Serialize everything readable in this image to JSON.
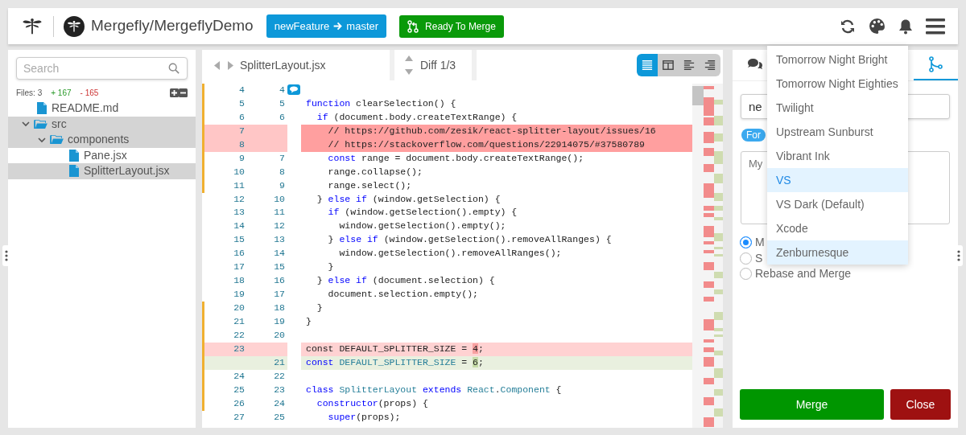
{
  "header": {
    "repo": "Mergefly/MergeflyDemo",
    "branch": {
      "source": "newFeature",
      "target": "master"
    },
    "status_button": "Ready To Merge"
  },
  "sidebar": {
    "search": {
      "placeholder": "Search"
    },
    "files_count": "Files: 3",
    "additions": "+ 167",
    "deletions": "- 165",
    "tree": [
      {
        "kind": "file",
        "name": "README.md",
        "selected": false
      },
      {
        "kind": "folder",
        "name": "src",
        "expanded": true,
        "selected": true,
        "children": [
          {
            "kind": "folder",
            "name": "components",
            "expanded": true,
            "selected": true,
            "children": [
              {
                "kind": "file",
                "name": "Pane.jsx",
                "selected": false
              },
              {
                "kind": "file",
                "name": "SplitterLayout.jsx",
                "selected": true
              }
            ]
          }
        ]
      }
    ]
  },
  "editor": {
    "file": "SplitterLayout.jsx",
    "diff_position": "Diff 1/3",
    "view_modes": [
      {
        "kind": "unified",
        "selected": true
      },
      {
        "kind": "split",
        "selected": false
      },
      {
        "kind": "left",
        "selected": false
      },
      {
        "kind": "right",
        "selected": false
      }
    ],
    "rows": [
      {
        "old": "4",
        "new": "4",
        "kind": "context",
        "hunk": true,
        "comment": true
      },
      {
        "old": "5",
        "new": "5",
        "kind": "context",
        "hunk": true,
        "code": [
          {
            "kind": "keyword",
            "text": "function"
          },
          {
            "kind": "plain",
            "text": " clearSelection() {"
          }
        ]
      },
      {
        "old": "6",
        "new": "6",
        "kind": "context",
        "hunk": true,
        "code": [
          {
            "kind": "keyword",
            "text": "  if"
          },
          {
            "kind": "plain",
            "text": " (document.body.createTextRange) {"
          }
        ]
      },
      {
        "old": "7",
        "kind": "deleted",
        "hunk": true,
        "code": [
          {
            "kind": "plain",
            "text": "    // https://github.com/zesik/react-splitter-layout/issues/16"
          }
        ]
      },
      {
        "old": "8",
        "kind": "deleted",
        "hunk": true,
        "code": [
          {
            "kind": "plain",
            "text": "    // https://stackoverflow.com/questions/22914075/#37580789"
          }
        ]
      },
      {
        "old": "9",
        "new": "7",
        "kind": "context",
        "hunk": true,
        "code": [
          {
            "kind": "keyword",
            "text": "    const"
          },
          {
            "kind": "plain",
            "text": " range = document.body.createTextRange();"
          }
        ]
      },
      {
        "old": "10",
        "new": "8",
        "kind": "context",
        "hunk": true,
        "code": [
          {
            "kind": "plain",
            "text": "    range.collapse();"
          }
        ]
      },
      {
        "old": "11",
        "new": "9",
        "kind": "context",
        "hunk": true,
        "code": [
          {
            "kind": "plain",
            "text": "    range.select();"
          }
        ]
      },
      {
        "old": "12",
        "new": "10",
        "kind": "context",
        "hunk": false,
        "code": [
          {
            "kind": "plain",
            "text": "  } "
          },
          {
            "kind": "keyword",
            "text": "else if"
          },
          {
            "kind": "plain",
            "text": " (window.getSelection) {"
          }
        ]
      },
      {
        "old": "13",
        "new": "11",
        "kind": "context",
        "hunk": false,
        "code": [
          {
            "kind": "keyword",
            "text": "    if"
          },
          {
            "kind": "plain",
            "text": " (window.getSelection().empty) {"
          }
        ]
      },
      {
        "old": "14",
        "new": "12",
        "kind": "context",
        "hunk": false,
        "code": [
          {
            "kind": "plain",
            "text": "      window.getSelection().empty();"
          }
        ]
      },
      {
        "old": "15",
        "new": "13",
        "kind": "context",
        "hunk": false,
        "code": [
          {
            "kind": "plain",
            "text": "    } "
          },
          {
            "kind": "keyword",
            "text": "else if"
          },
          {
            "kind": "plain",
            "text": " (window.getSelection().removeAllRanges) {"
          }
        ]
      },
      {
        "old": "16",
        "new": "14",
        "kind": "context",
        "hunk": false,
        "code": [
          {
            "kind": "plain",
            "text": "      window.getSelection().removeAllRanges();"
          }
        ]
      },
      {
        "old": "17",
        "new": "15",
        "kind": "context",
        "hunk": false,
        "code": [
          {
            "kind": "plain",
            "text": "    }"
          }
        ]
      },
      {
        "old": "18",
        "new": "16",
        "kind": "context",
        "hunk": false,
        "code": [
          {
            "kind": "plain",
            "text": "  } "
          },
          {
            "kind": "keyword",
            "text": "else if"
          },
          {
            "kind": "plain",
            "text": " (document.selection) {"
          }
        ]
      },
      {
        "old": "19",
        "new": "17",
        "kind": "context",
        "hunk": false,
        "code": [
          {
            "kind": "plain",
            "text": "    document.selection.empty();"
          }
        ]
      },
      {
        "old": "20",
        "new": "18",
        "kind": "context",
        "hunk": true,
        "code": [
          {
            "kind": "plain",
            "text": "  }"
          }
        ]
      },
      {
        "old": "21",
        "new": "19",
        "kind": "context",
        "hunk": true,
        "code": [
          {
            "kind": "plain",
            "text": "}"
          }
        ]
      },
      {
        "old": "22",
        "new": "20",
        "kind": "context",
        "hunk": true
      },
      {
        "old": "23",
        "kind": "changed_old",
        "hunk": true,
        "code": [
          {
            "kind": "plain",
            "text": "const DEFAULT_SPLITTER_SIZE = "
          },
          {
            "kind": "changed",
            "text": "4"
          },
          {
            "kind": "plain",
            "text": ";"
          }
        ]
      },
      {
        "new": "21",
        "kind": "changed_new",
        "hunk": true,
        "code": [
          {
            "kind": "keyword",
            "text": "const"
          },
          {
            "kind": "type",
            "text": " DEFAULT_SPLITTER_SIZE"
          },
          {
            "kind": "plain",
            "text": " = "
          },
          {
            "kind": "changed",
            "text": "6"
          },
          {
            "kind": "plain",
            "text": ";"
          }
        ]
      },
      {
        "old": "24",
        "new": "22",
        "kind": "context",
        "hunk": true
      },
      {
        "old": "25",
        "new": "23",
        "kind": "context",
        "hunk": true,
        "code": [
          {
            "kind": "keyword",
            "text": "class"
          },
          {
            "kind": "type",
            "text": " SplitterLayout"
          },
          {
            "kind": "keyword",
            "text": " extends"
          },
          {
            "kind": "type",
            "text": " React"
          },
          {
            "kind": "plain",
            "text": "."
          },
          {
            "kind": "type",
            "text": "Component"
          },
          {
            "kind": "plain",
            "text": " {"
          }
        ]
      },
      {
        "old": "26",
        "new": "24",
        "kind": "context",
        "hunk": true,
        "code": [
          {
            "kind": "keyword",
            "text": "  constructor"
          },
          {
            "kind": "plain",
            "text": "(props) {"
          }
        ]
      },
      {
        "old": "27",
        "new": "25",
        "kind": "context",
        "hunk": false,
        "code": [
          {
            "kind": "keyword",
            "text": "    super"
          },
          {
            "kind": "plain",
            "text": "(props);"
          }
        ]
      }
    ]
  },
  "merge_panel": {
    "tabs": [
      {
        "kind": "comments",
        "selected": false
      },
      {
        "kind": "merge",
        "selected": true
      }
    ],
    "title_value": "ne",
    "badge": "For",
    "description_placeholder": "My",
    "options": [
      {
        "label": "M",
        "selected": true
      },
      {
        "label": "S",
        "selected": false
      },
      {
        "label": "Rebase and Merge",
        "selected": false
      }
    ],
    "merge_button": "Merge",
    "close_button": "Close"
  },
  "theme_menu": {
    "items": [
      {
        "label": "Tomorrow Night Bright",
        "selected": false,
        "hovered": false
      },
      {
        "label": "Tomorrow Night Eighties",
        "selected": false,
        "hovered": false
      },
      {
        "label": "Twilight",
        "selected": false,
        "hovered": false
      },
      {
        "label": "Upstream Sunburst",
        "selected": false,
        "hovered": false
      },
      {
        "label": "Vibrant Ink",
        "selected": false,
        "hovered": false
      },
      {
        "label": "VS",
        "selected": true,
        "hovered": false
      },
      {
        "label": "VS Dark (Default)",
        "selected": false,
        "hovered": false
      },
      {
        "label": "Xcode",
        "selected": false,
        "hovered": false
      },
      {
        "label": "Zenburnesque",
        "selected": false,
        "hovered": true
      }
    ]
  }
}
